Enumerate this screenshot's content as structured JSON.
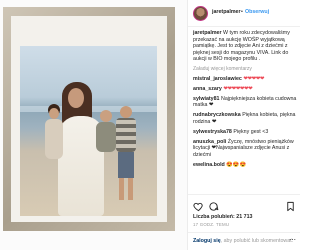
{
  "header": {
    "username": "jaretpalmer",
    "separator": "•",
    "follow_label": "Obserwuj"
  },
  "caption": {
    "author": "jaretpalmer",
    "text": "W tym roku zdecydowaliśmy przekazać na aukcję WOŚP wyjątkową pamiątkę. Jest to zdjęcie Ani z dziećmi z pięknej sesji do magazynu VIVA. Link do aukcji w BIO mojego profilu ."
  },
  "load_more": "Załaduj więcej komentarzy",
  "comments": [
    {
      "user": "mistral_jaroslawiec",
      "text": "❤❤❤❤❤"
    },
    {
      "user": "anna_szary",
      "text": "❤❤❤❤❤❤❤"
    },
    {
      "user": "sylwiaty81",
      "text": "Najpiękniejsza kobieta cudowna matka ❤"
    },
    {
      "user": "rudnabryczkowska",
      "text": "Piękna kobieta, piękna rodzina ❤"
    },
    {
      "user": "sylwestryska78",
      "text": "Piękny gest <3"
    },
    {
      "user": "anuszka_poli",
      "text": "Życzę, mnóstwo pieniążków licytacji ❤Najwspanialsze zdjęcie Anusi z dziećmi"
    },
    {
      "user": "ewelina.bold",
      "text": "😍😍😍"
    }
  ],
  "actions": {
    "likes": "Liczba polubień: 21 713",
    "date": "17 GODZ. TEMU"
  },
  "footer": {
    "login_link": "Zaloguj się",
    "login_rest": ", aby polubić lub skomentować"
  },
  "colors": {
    "link_blue": "#3897f0",
    "heart_red": "#ed4956",
    "text": "#262626",
    "muted": "#999999"
  },
  "icons": [
    "heart-icon",
    "comment-icon",
    "bookmark-icon",
    "more-options-icon"
  ]
}
